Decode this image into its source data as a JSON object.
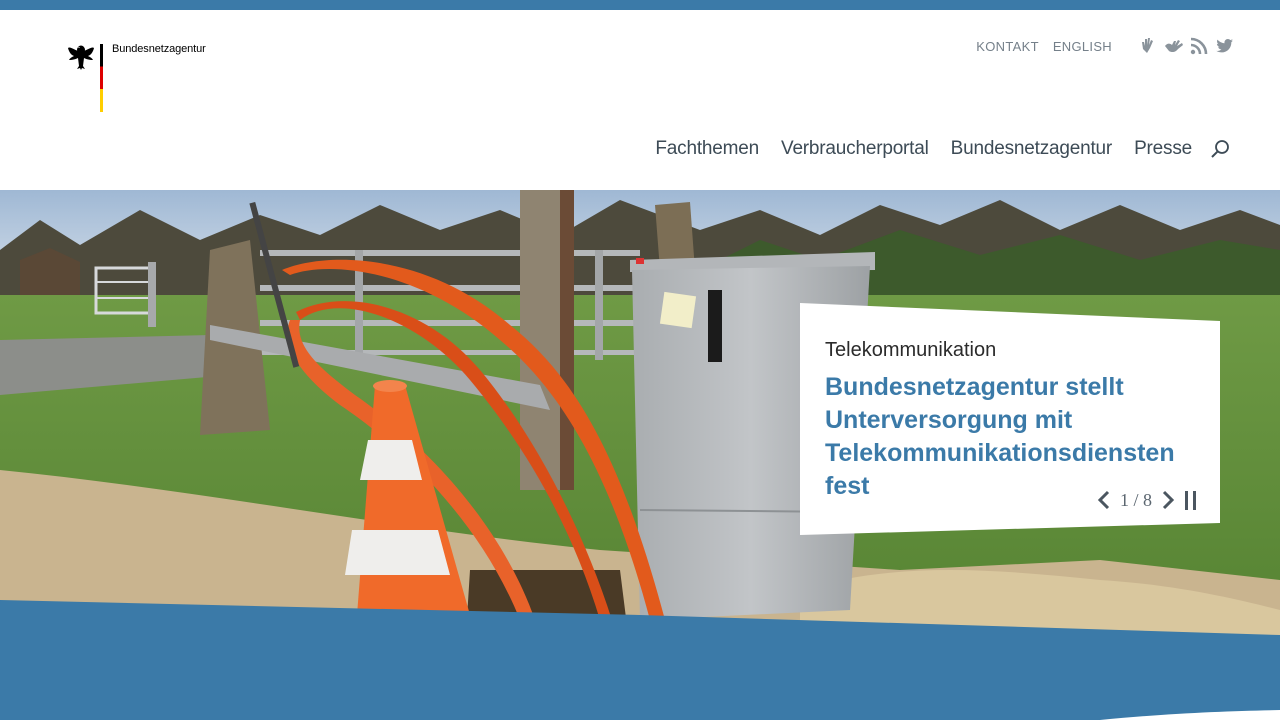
{
  "brand": {
    "name": "Bundesnetzagentur"
  },
  "utility_nav": {
    "links": [
      {
        "label": "KONTAKT"
      },
      {
        "label": "ENGLISH"
      }
    ],
    "icons": [
      "sign-language-icon",
      "easy-language-icon",
      "rss-icon",
      "twitter-icon"
    ]
  },
  "main_nav": {
    "items": [
      {
        "label": "Fachthemen"
      },
      {
        "label": "Verbraucherportal"
      },
      {
        "label": "Bundesnetzagentur"
      },
      {
        "label": "Presse"
      }
    ],
    "search_icon": "search-icon"
  },
  "hero": {
    "category": "Telekommunikation",
    "title": "Bundesnetzagentur stellt Unterversorgung mit Telekommunikationsdiensten fest",
    "slider": {
      "current": 1,
      "total": 8,
      "counter_text": "1 / 8"
    }
  },
  "colors": {
    "accent": "#3b7aa8",
    "nav_text": "#3d4b56",
    "utility_text": "#75808a"
  }
}
